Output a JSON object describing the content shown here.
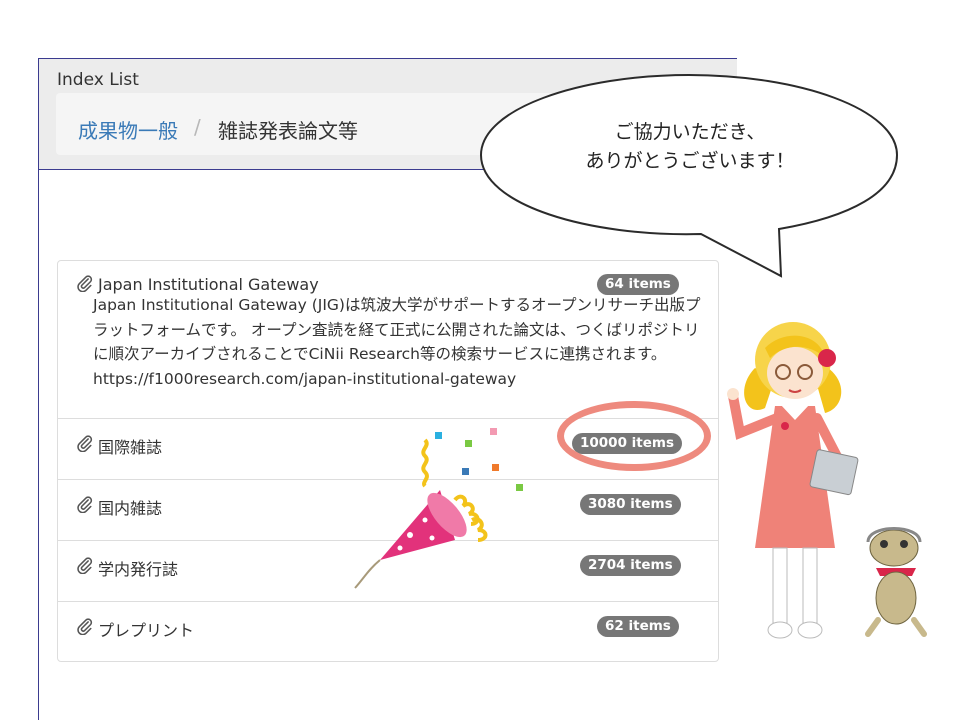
{
  "panel": {
    "title": "Index List"
  },
  "breadcrumb": {
    "parent": "成果物一般",
    "separator": "/",
    "current": "雑誌発表論文等"
  },
  "indexes": [
    {
      "name": "Japan Institutional Gateway",
      "count": "64 items",
      "description": "Japan Institutional Gateway (JIG)は筑波大学がサポートするオープンリサーチ出版プラットフォームです。 オープン査読を経て正式に公開された論文は、つくばリポジトリに順次アーカイブされることでCiNii Research等の検索サービスに連携されます。 https://f1000research.com/japan-institutional-gateway"
    },
    {
      "name": "国際雑誌",
      "count": "10000 items"
    },
    {
      "name": "国内雑誌",
      "count": "3080 items"
    },
    {
      "name": "学内発行誌",
      "count": "2704 items"
    },
    {
      "name": "プレプリント",
      "count": "62 items"
    }
  ],
  "speech_bubble": {
    "line1": "ご協力いただき、",
    "line2": "ありがとうございます！"
  },
  "colors": {
    "badge": "#777777",
    "link": "#3a7ab7",
    "highlight": "#ee8a7e",
    "frame": "#3b3b8f"
  },
  "icons": [
    "paperclip-icon",
    "party-popper-icon"
  ]
}
